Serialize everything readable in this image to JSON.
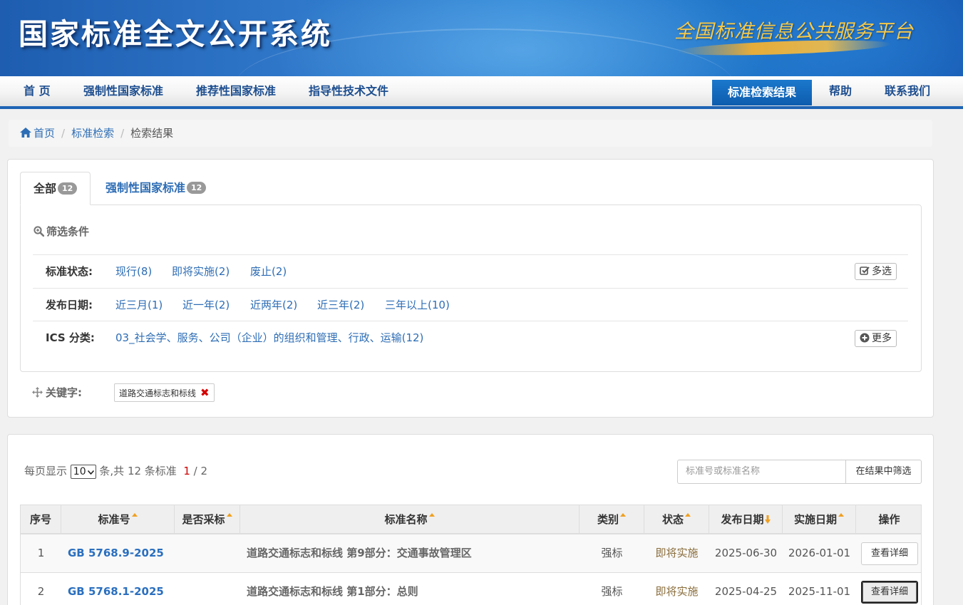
{
  "banner": {
    "title": "国家标准全文公开系统",
    "slogan": "全国标准信息公共服务平台"
  },
  "nav": {
    "items": [
      "首 页",
      "强制性国家标准",
      "推荐性国家标准",
      "指导性技术文件"
    ],
    "active": "标准检索结果",
    "right_items": [
      "帮助",
      "联系我们"
    ]
  },
  "breadcrumb": {
    "home": "首页",
    "search": "标准检索",
    "current": "检索结果"
  },
  "tabs": [
    {
      "label": "全部",
      "count": "12"
    },
    {
      "label": "强制性国家标准",
      "count": "12"
    }
  ],
  "filters": {
    "title": "筛选条件",
    "status": {
      "label": "标准状态:",
      "options": [
        "现行(8)",
        "即将实施(2)",
        "废止(2)"
      ],
      "button": "多选"
    },
    "date": {
      "label": "发布日期:",
      "options": [
        "近三月(1)",
        "近一年(2)",
        "近两年(2)",
        "近三年(2)",
        "三年以上(10)"
      ]
    },
    "ics": {
      "label": "ICS 分类:",
      "options": [
        "03_社会学、服务、公司（企业）的组织和管理、行政、运输(12)"
      ],
      "button": "更多"
    }
  },
  "keyword": {
    "label": "关键字:",
    "value": "道路交通标志和标线",
    "remove": "✖"
  },
  "results": {
    "per_page_prefix": "每页显示",
    "per_page_value": "10",
    "per_page_suffix": "条,共 12 条标准",
    "page_current": "1",
    "page_total": " / 2",
    "search_placeholder": "标准号或标准名称",
    "search_button": "在结果中筛选",
    "columns": [
      "序号",
      "标准号",
      "是否采标",
      "标准名称",
      "类别",
      "状态",
      "发布日期",
      "实施日期",
      "操作"
    ],
    "rows": [
      {
        "no": "1",
        "code": "GB 5768.9-2025",
        "adopted": "",
        "name": "道路交通标志和标线 第9部分：交通事故管理区",
        "category": "强标",
        "status": "即将实施",
        "publish": "2025-06-30",
        "implement": "2026-01-01",
        "action": "查看详细"
      },
      {
        "no": "2",
        "code": "GB 5768.1-2025",
        "adopted": "",
        "name": "道路交通标志和标线 第1部分：总则",
        "category": "强标",
        "status": "即将实施",
        "publish": "2025-04-25",
        "implement": "2025-11-01",
        "action": "查看详细"
      }
    ]
  },
  "colors": {
    "brand_blue": "#1e64b4",
    "link_blue": "#2d6db5",
    "sort_orange": "#f0a020",
    "remove_red": "#d40000"
  },
  "icons": [
    "home-icon",
    "zoom-search-icon",
    "check-square-icon",
    "plus-circle-icon",
    "move-arrows-icon",
    "sort-up-icon",
    "sort-down-icon",
    "chevron-down-icon"
  ]
}
